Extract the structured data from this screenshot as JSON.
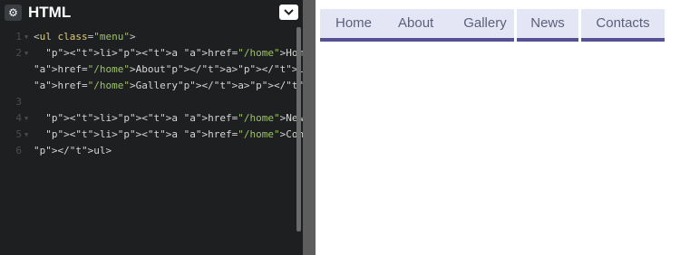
{
  "editor": {
    "title": "HTML",
    "gear_icon": "⚙",
    "line_numbers": [
      "1",
      "2",
      "3",
      "4",
      "5"
    ]
  },
  "code": {
    "line1": {
      "open": "<",
      "tag": "ul",
      "attr": " class",
      "eq": "=",
      "val": "\"menu\"",
      "close": ">"
    },
    "line2a": {
      "text": "  <li><a href=\"/home\">Home</a></li><li><a"
    },
    "line2b": {
      "text": "href=\"/home\">About</a></li><li><a"
    },
    "line2c": {
      "text": "href=\"/home\">Gallery</a></li>"
    },
    "line4": {
      "text": "  <li><a href=\"/home\">News</a></li>"
    },
    "line5": {
      "text": "  <li><a href=\"/home\">Contacts</a></li>"
    },
    "line6": {
      "text": "</ul>"
    }
  },
  "menu": {
    "items": [
      {
        "label": "Home"
      },
      {
        "label": "About"
      },
      {
        "label": "Gallery"
      },
      {
        "label": "News"
      },
      {
        "label": "Contacts"
      }
    ]
  },
  "colors": {
    "editor_bg": "#1d1f20",
    "menu_bg": "#e5e6f5",
    "menu_border": "#565192",
    "menu_text": "#5c5f7a"
  }
}
